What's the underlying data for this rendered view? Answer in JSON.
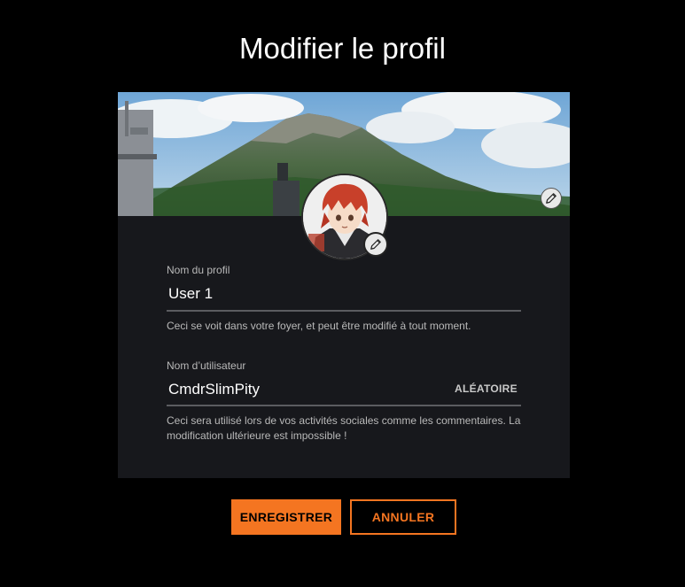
{
  "page": {
    "title": "Modifier le profil"
  },
  "profile_card": {
    "banner_icon": "pencil-icon",
    "avatar_icon": "pencil-icon",
    "profile_name": {
      "label": "Nom du profil",
      "value": "User 1",
      "help": "Ceci se voit dans votre foyer, et peut être modifié à tout moment."
    },
    "username": {
      "label": "Nom d’utilisateur",
      "value": "CmdrSlimPity",
      "random_label": "ALÉATOIRE",
      "help": "Ceci sera utilisé lors de vos activités sociales comme les commentaires. La modification ultérieure est impossible !"
    }
  },
  "actions": {
    "save_label": "ENREGISTRER",
    "cancel_label": "ANNULER"
  },
  "colors": {
    "accent": "#f47521",
    "background": "#000000",
    "card": "#17181c"
  }
}
